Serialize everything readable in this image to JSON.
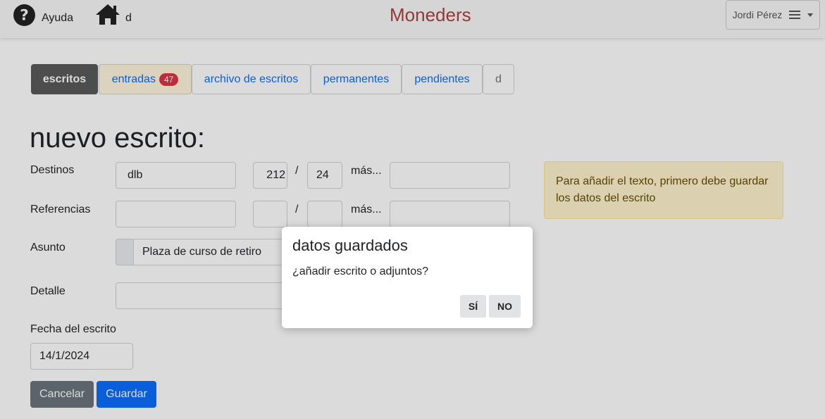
{
  "topbar": {
    "help_label": "Ayuda",
    "home_label": "d",
    "brand": "Moneders",
    "user_name": "Jordi Pérez"
  },
  "tabs": [
    {
      "label": "escritos",
      "active": true
    },
    {
      "label": "entradas",
      "badge": "47"
    },
    {
      "label": "archivo de escritos"
    },
    {
      "label": "permanentes"
    },
    {
      "label": "pendientes"
    },
    {
      "label": "d"
    }
  ],
  "form": {
    "title": "nuevo escrito:",
    "destinos": {
      "label": "Destinos",
      "value": "dlb",
      "num": "212",
      "year": "24",
      "more": "más...",
      "more_value": ""
    },
    "referencias": {
      "label": "Referencias",
      "value": "",
      "num": "",
      "year": "",
      "more": "más...",
      "more_value": ""
    },
    "separator": "/",
    "asunto": {
      "label": "Asunto",
      "value": "Plaza de curso de retiro"
    },
    "detalle": {
      "label": "Detalle",
      "value": ""
    },
    "fecha": {
      "label": "Fecha del escrito",
      "value": "14/1/2024"
    },
    "cancel_label": "Cancelar",
    "save_label": "Guardar"
  },
  "alert": {
    "text": "Para añadir el texto, primero debe guardar los datos del escrito"
  },
  "modal": {
    "title": "datos guardados",
    "body": "¿añadir escrito o adjuntos?",
    "yes_label": "SÍ",
    "no_label": "NO"
  },
  "colors": {
    "brand": "#a94442",
    "link": "#0d6efd",
    "badge": "#dc3545",
    "active_tab": "#5a5a5a",
    "save_button": "#0d6efd",
    "cancel_button": "#6c757d",
    "alert_bg": "#fff3cd"
  },
  "icons": {
    "help": "question-circle-icon",
    "home": "home-icon",
    "menu": "hamburger-menu-icon"
  }
}
